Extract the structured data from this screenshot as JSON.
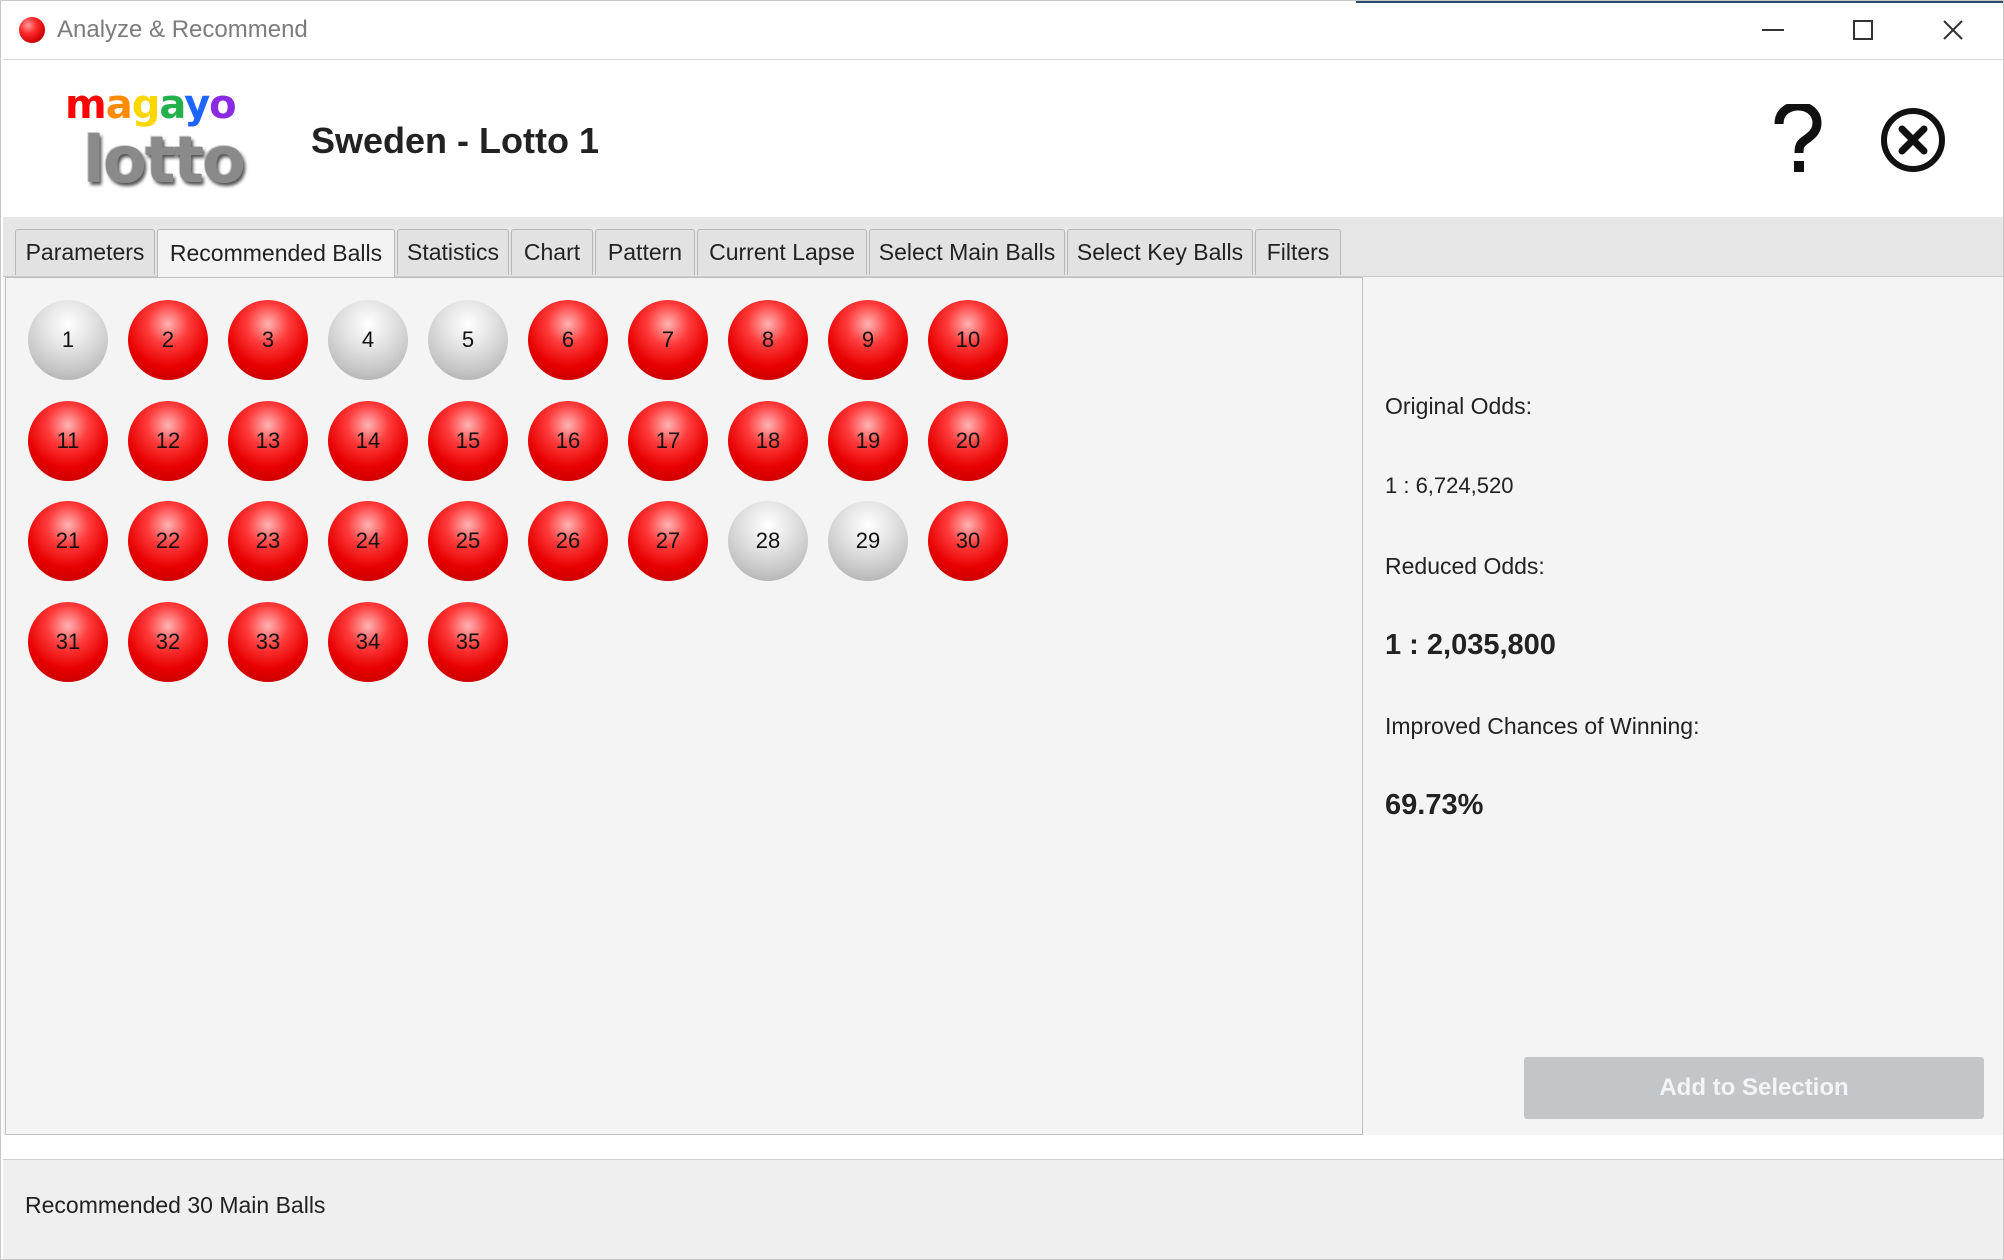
{
  "window": {
    "title": "Analyze & Recommend",
    "controls": [
      "minimize",
      "maximize",
      "close"
    ]
  },
  "header": {
    "logo_top": "magayo",
    "logo_bottom": "lotto",
    "logo_colors": [
      "#ff0000",
      "#ff8c00",
      "#ffd700",
      "#22b14c",
      "#1e64ff",
      "#8a2be2",
      "#e000c0"
    ],
    "game_title": "Sweden - Lotto 1",
    "help_icon": "question-mark-icon",
    "close_icon": "circle-x-icon"
  },
  "tabs": [
    {
      "label": "Parameters",
      "active": false
    },
    {
      "label": "Recommended Balls",
      "active": true
    },
    {
      "label": "Statistics",
      "active": false
    },
    {
      "label": "Chart",
      "active": false
    },
    {
      "label": "Pattern",
      "active": false
    },
    {
      "label": "Current Lapse",
      "active": false
    },
    {
      "label": "Select Main Balls",
      "active": false
    },
    {
      "label": "Select Key Balls",
      "active": false
    },
    {
      "label": "Filters",
      "active": false
    }
  ],
  "balls": [
    {
      "number": "1",
      "recommended": false
    },
    {
      "number": "2",
      "recommended": true
    },
    {
      "number": "3",
      "recommended": true
    },
    {
      "number": "4",
      "recommended": false
    },
    {
      "number": "5",
      "recommended": false
    },
    {
      "number": "6",
      "recommended": true
    },
    {
      "number": "7",
      "recommended": true
    },
    {
      "number": "8",
      "recommended": true
    },
    {
      "number": "9",
      "recommended": true
    },
    {
      "number": "10",
      "recommended": true
    },
    {
      "number": "11",
      "recommended": true
    },
    {
      "number": "12",
      "recommended": true
    },
    {
      "number": "13",
      "recommended": true
    },
    {
      "number": "14",
      "recommended": true
    },
    {
      "number": "15",
      "recommended": true
    },
    {
      "number": "16",
      "recommended": true
    },
    {
      "number": "17",
      "recommended": true
    },
    {
      "number": "18",
      "recommended": true
    },
    {
      "number": "19",
      "recommended": true
    },
    {
      "number": "20",
      "recommended": true
    },
    {
      "number": "21",
      "recommended": true
    },
    {
      "number": "22",
      "recommended": true
    },
    {
      "number": "23",
      "recommended": true
    },
    {
      "number": "24",
      "recommended": true
    },
    {
      "number": "25",
      "recommended": true
    },
    {
      "number": "26",
      "recommended": true
    },
    {
      "number": "27",
      "recommended": true
    },
    {
      "number": "28",
      "recommended": false
    },
    {
      "number": "29",
      "recommended": false
    },
    {
      "number": "30",
      "recommended": true
    },
    {
      "number": "31",
      "recommended": true
    },
    {
      "number": "32",
      "recommended": true
    },
    {
      "number": "33",
      "recommended": true
    },
    {
      "number": "34",
      "recommended": true
    },
    {
      "number": "35",
      "recommended": true
    }
  ],
  "odds": {
    "original_label": "Original Odds:",
    "original_value": "1 : 6,724,520",
    "reduced_label": "Reduced Odds:",
    "reduced_value": "1 : 2,035,800",
    "improved_label": "Improved Chances of Winning:",
    "improved_value": "69.73%"
  },
  "actions": {
    "add_to_selection": "Add to Selection"
  },
  "status": {
    "message": "Recommended 30 Main Balls"
  },
  "colors": {
    "recommended_ball": "#e80000",
    "unrecommended_ball": "#c4c4c4",
    "button_disabled": "#c3c6c9"
  }
}
